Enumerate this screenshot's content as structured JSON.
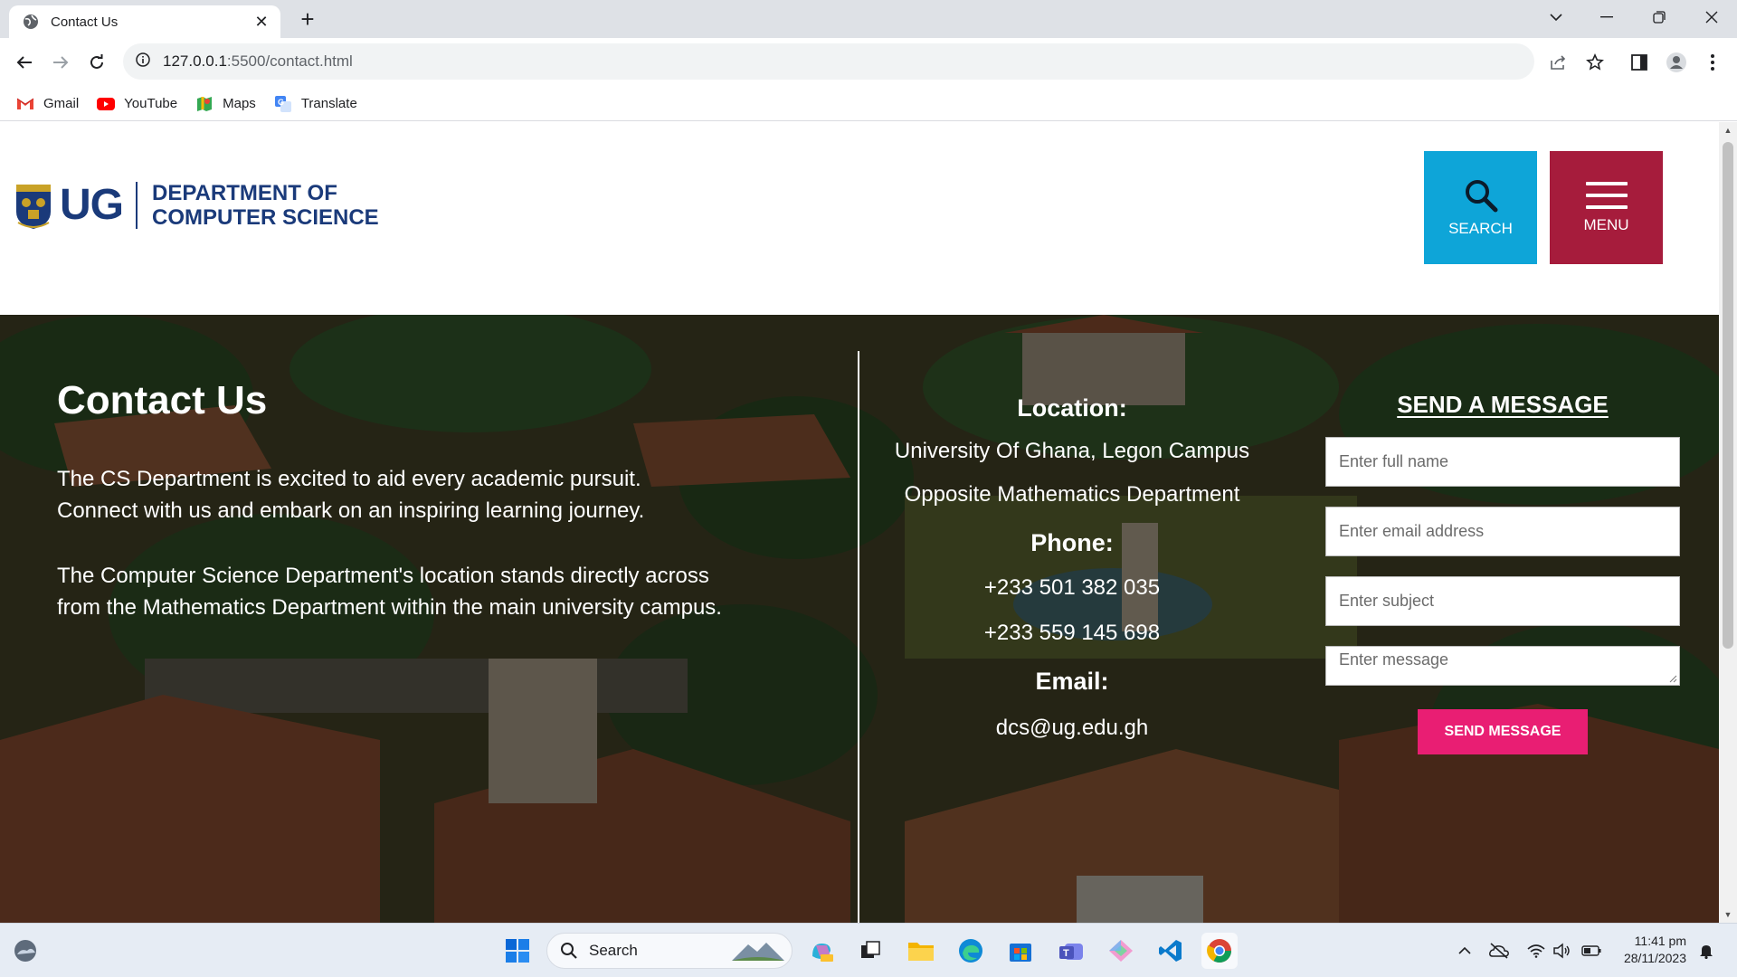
{
  "browser": {
    "tab_title": "Contact Us",
    "url_host": "127.0.0.1",
    "url_path": ":5500/contact.html",
    "bookmarks": [
      {
        "label": "Gmail",
        "icon": "gmail-icon"
      },
      {
        "label": "YouTube",
        "icon": "youtube-icon"
      },
      {
        "label": "Maps",
        "icon": "maps-icon"
      },
      {
        "label": "Translate",
        "icon": "translate-icon"
      }
    ]
  },
  "site": {
    "logo_text": "UG",
    "dept_line1": "DEPARTMENT OF",
    "dept_line2": "COMPUTER SCIENCE",
    "search_label": "SEARCH",
    "menu_label": "MENU",
    "colors": {
      "brand_blue": "#1a3a7a",
      "search_bg": "#0ea5d8",
      "menu_bg": "#a61c3c",
      "send_bg": "#e91e73"
    }
  },
  "contact": {
    "title": "Contact Us",
    "para1_line1": "The CS Department is excited to aid every academic pursuit.",
    "para1_line2": "Connect with us and embark on an inspiring learning journey.",
    "para2_line1": "The Computer Science Department's location stands directly across",
    "para2_line2": "from the Mathematics Department within the main university campus.",
    "location_label": "Location:",
    "location_line1": "University Of Ghana, Legon Campus",
    "location_line2": "Opposite Mathematics Department",
    "phone_label": "Phone:",
    "phone1": "+233 501 382 035",
    "phone2": "+233 559 145 698",
    "email_label": "Email:",
    "email": "dcs@ug.edu.gh"
  },
  "form": {
    "title": "SEND A MESSAGE",
    "name_placeholder": "Enter full name",
    "email_placeholder": "Enter email address",
    "subject_placeholder": "Enter subject",
    "message_placeholder": "Enter message",
    "submit_label": "SEND MESSAGE"
  },
  "taskbar": {
    "search_label": "Search",
    "time": "11:41 pm",
    "date": "28/11/2023"
  }
}
